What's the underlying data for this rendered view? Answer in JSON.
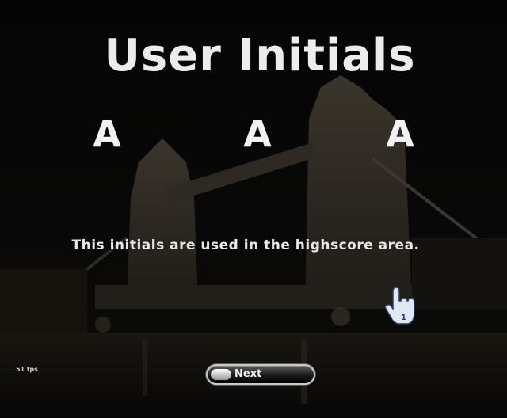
{
  "title": "User Initials",
  "initials": [
    "A",
    "A",
    "A"
  ],
  "info_text": "This initials are used in the highscore area.",
  "fps_text": "51 fps",
  "next_button": {
    "label": "Next"
  },
  "cursor": {
    "badge": "1"
  }
}
